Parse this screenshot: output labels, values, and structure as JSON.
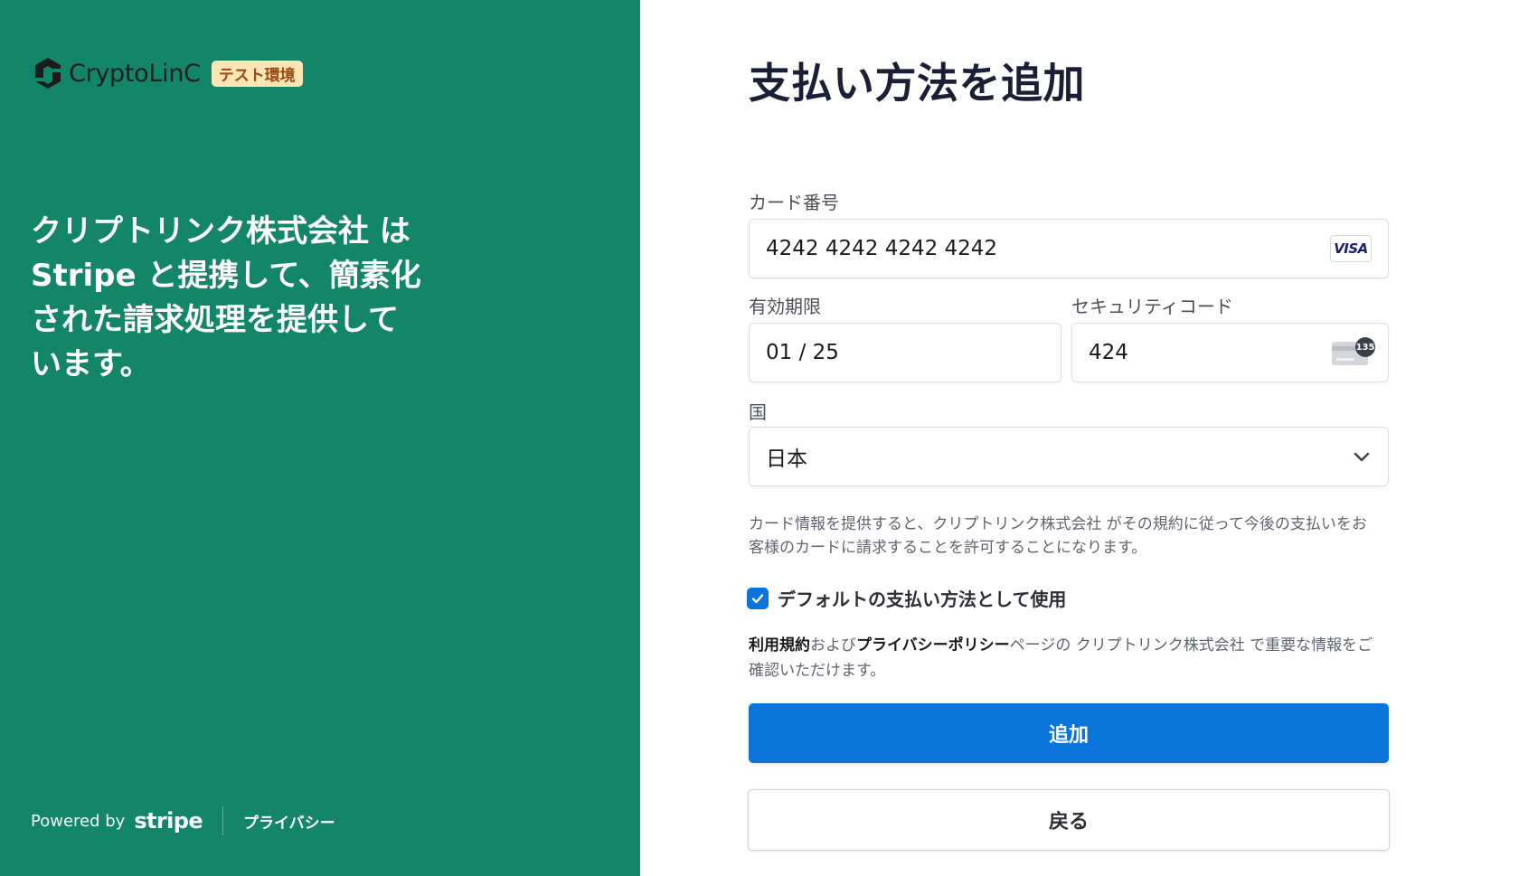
{
  "colors": {
    "left_panel_bg": "#13866a",
    "primary_button": "#0a74da",
    "test_badge_bg": "#fde6b4",
    "test_badge_text": "#9a4a14"
  },
  "merchant": {
    "brand_name": "CryptoLinC",
    "logo_icon": "cryptolinc-logo-icon",
    "test_badge": "テスト環境",
    "tagline": "クリプトリンク株式会社 は Stripe と提携して、簡素化された請求処理を提供しています。"
  },
  "footer": {
    "powered_by": "Powered by",
    "stripe": "stripe",
    "privacy": "プライバシー"
  },
  "form": {
    "title": "支払い方法を追加",
    "card_number": {
      "label": "カード番号",
      "value": "4242 4242 4242 4242",
      "brand": "VISA",
      "brand_icon": "visa-icon"
    },
    "expiry": {
      "label": "有効期限",
      "value": "01 / 25"
    },
    "cvc": {
      "label": "セキュリティコード",
      "value": "424",
      "icon": "cvc-card-icon",
      "icon_badge": "135"
    },
    "country": {
      "label": "国",
      "value": "日本",
      "icon": "chevron-down-icon"
    },
    "notice": "カード情報を提供すると、クリプトリンク株式会社 がその規約に従って今後の支払いをお客様のカードに請求することを許可することになります。",
    "default_checkbox": {
      "label": "デフォルトの支払い方法として使用",
      "checked": true,
      "icon": "check-icon"
    },
    "terms": {
      "terms_link": "利用規約",
      "and": "および",
      "privacy_link": "プライバシーポリシー",
      "rest": "ページの クリプトリンク株式会社 で重要な情報をご確認いただけます。"
    },
    "submit_button": "追加",
    "back_button": "戻る"
  }
}
